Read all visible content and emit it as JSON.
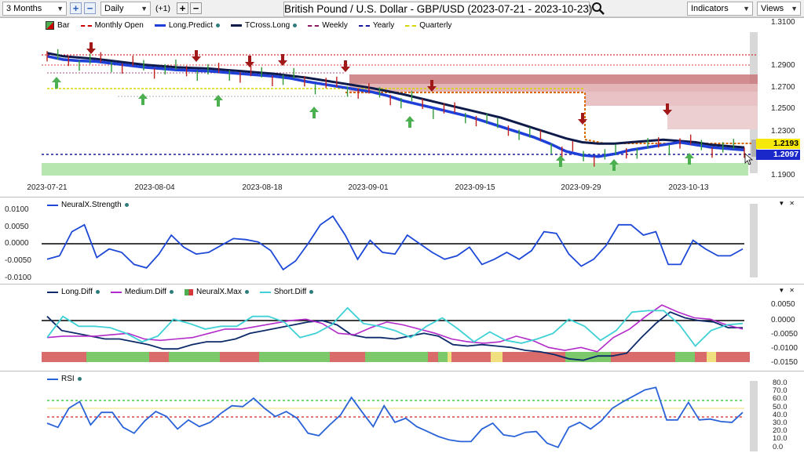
{
  "toolbar": {
    "range": "3 Months",
    "zoom_in": "+",
    "zoom_out": "−",
    "interval": "Daily",
    "offset": "(+1)",
    "step_plus": "+",
    "step_minus": "−",
    "title": "British Pound / U.S. Dollar - GBP/USD (2023-07-21 - 2023-10-23)",
    "indicators": "Indicators",
    "views": "Views"
  },
  "colors": {
    "long_predict": "#1e3fd8",
    "tcross": "#0d1a4a",
    "monthly_open": "#cc0000",
    "weekly": "#8b1a60",
    "yearly": "#1a1aa0",
    "quarterly": "#d6d600",
    "up_arrow": "#4caf50",
    "down_arrow": "#a01818",
    "neural_strength": "#1e49d8",
    "long_diff": "#0d2a6a",
    "medium_diff": "#b22ac9",
    "short_diff": "#3fd1d6",
    "rsi": "#2a63d8"
  },
  "price_panel": {
    "legend": [
      {
        "label": "Bar",
        "icon": "bar-icon"
      },
      {
        "label": "Monthly Open",
        "color": "#cc0000",
        "style": "dashed"
      },
      {
        "label": "Long.Predict",
        "color": "#1e3fd8",
        "style": "solid",
        "dot": true
      },
      {
        "label": "TCross.Long",
        "color": "#0d1a4a",
        "style": "solid",
        "dot": true
      },
      {
        "label": "Weekly",
        "color": "#8b1a60",
        "style": "dashed"
      },
      {
        "label": "Yearly",
        "color": "#1a1aa0",
        "style": "dashed"
      },
      {
        "label": "Quarterly",
        "color": "#d6d600",
        "style": "dashed"
      }
    ],
    "y_ticks": [
      "1.3100",
      "1.2900",
      "1.2700",
      "1.2500",
      "1.2300",
      "1.2100",
      "1.1900"
    ],
    "x_ticks": [
      "2023-07-21",
      "2023-08-04",
      "2023-08-18",
      "2023-09-01",
      "2023-09-15",
      "2023-09-29",
      "2023-10-13"
    ],
    "last_price": "1.2193",
    "yearly_level": "1.2097"
  },
  "neural_panel": {
    "legend": "NeuralX.Strength",
    "y_ticks": [
      "0.0100",
      "0.0050",
      "0.0000",
      "-0.0050",
      "-0.0100"
    ]
  },
  "diff_panel": {
    "legend": [
      "Long.Diff",
      "Medium.Diff",
      "NeuralX.Max",
      "Short.Diff"
    ],
    "y_ticks": [
      "0.0050",
      "0.0000",
      "-0.0050",
      "-0.0100",
      "-0.0150"
    ]
  },
  "rsi_panel": {
    "legend": "RSI",
    "y_ticks": [
      "80.0",
      "70.0",
      "60.0",
      "50.0",
      "40.0",
      "30.0",
      "20.0",
      "10.0",
      "0.0"
    ]
  },
  "chart_data": [
    {
      "type": "line",
      "title": "British Pound / U.S. Dollar - GBP/USD (2023-07-21 - 2023-10-23)",
      "x_range": [
        "2023-07-21",
        "2023-10-23"
      ],
      "ylim": [
        1.19,
        1.31
      ],
      "series": [
        {
          "name": "Long.Predict",
          "values": [
            1.2895,
            1.287,
            1.286,
            1.2855,
            1.284,
            1.2825,
            1.281,
            1.28,
            1.279,
            1.2785,
            1.278,
            1.277,
            1.276,
            1.275,
            1.274,
            1.2725,
            1.27,
            1.268,
            1.266,
            1.264,
            1.262,
            1.259,
            1.255,
            1.252,
            1.249,
            1.246,
            1.243,
            1.239,
            1.235,
            1.231,
            1.227,
            1.222,
            1.216,
            1.213,
            1.212,
            1.214,
            1.217,
            1.219,
            1.221,
            1.223,
            1.221,
            1.219,
            1.218,
            1.217
          ]
        },
        {
          "name": "TCross.Long",
          "values": [
            1.292,
            1.2895,
            1.2885,
            1.2875,
            1.286,
            1.2845,
            1.283,
            1.282,
            1.281,
            1.2805,
            1.28,
            1.279,
            1.278,
            1.277,
            1.276,
            1.2745,
            1.273,
            1.271,
            1.269,
            1.267,
            1.265,
            1.2625,
            1.26,
            1.257,
            1.254,
            1.251,
            1.248,
            1.245,
            1.242,
            1.238,
            1.234,
            1.23,
            1.226,
            1.223,
            1.222,
            1.222,
            1.223,
            1.224,
            1.225,
            1.224,
            1.223,
            1.221,
            1.22,
            1.219
          ]
        },
        {
          "name": "Monthly Open",
          "values": [
            1.2855,
            1.2855,
            1.2855,
            1.2855,
            1.2855,
            1.2855,
            1.2855,
            1.2855,
            1.2855,
            1.2855,
            1.2855,
            1.2855,
            1.2855,
            1.2855,
            1.2855,
            1.2855,
            1.2855,
            1.2855,
            1.2855,
            1.2855,
            1.2855,
            1.2855,
            1.2855,
            1.2855,
            1.2855,
            1.2855,
            1.2855,
            1.2855,
            1.2855,
            1.2855,
            1.2855,
            1.2855,
            1.2855,
            1.2855,
            1.2855,
            1.2855,
            1.2855,
            1.2855,
            1.2855,
            1.2855,
            1.2855,
            1.2855,
            1.2855,
            1.2855
          ]
        },
        {
          "name": "Yearly",
          "values": [
            1.2097
          ]
        }
      ]
    },
    {
      "type": "line",
      "series": [
        {
          "name": "NeuralX.Strength",
          "values": [
            -0.0045,
            -0.0035,
            0.0035,
            0.0055,
            -0.004,
            -0.0015,
            -0.0025,
            -0.006,
            -0.007,
            -0.003,
            0.0025,
            -0.001,
            -0.003,
            -0.0025,
            -0.0005,
            0.0015,
            0.0012,
            0.0005,
            -0.002,
            -0.0075,
            -0.005,
            0.0,
            0.0055,
            0.008,
            0.0025,
            -0.0045,
            0.001,
            -0.0025,
            -0.003,
            0.0025,
            0.0,
            -0.0025,
            -0.0045,
            -0.0035,
            -0.001,
            -0.006,
            -0.0045,
            -0.0025,
            -0.0045,
            -0.002,
            0.0035,
            0.003,
            -0.003,
            -0.0065,
            -0.0045,
            -0.0005,
            0.0055,
            0.0055,
            0.0025,
            0.0035,
            -0.006,
            -0.006,
            0.001,
            -0.0015,
            -0.0035,
            -0.0035,
            -0.0015
          ]
        }
      ],
      "ylim": [
        -0.01,
        0.01
      ]
    },
    {
      "type": "line",
      "series": [
        {
          "name": "Long.Diff",
          "values": [
            0.0015,
            -0.0035,
            -0.0045,
            -0.0055,
            -0.0065,
            -0.0065,
            -0.0075,
            -0.0085,
            -0.01,
            -0.01,
            -0.0085,
            -0.0075,
            -0.0075,
            -0.0065,
            -0.0045,
            -0.0035,
            -0.0025,
            -0.0015,
            -0.0005,
            0.0,
            -0.0015,
            -0.005,
            -0.006,
            -0.006,
            -0.0065,
            -0.0055,
            -0.0045,
            -0.0055,
            -0.0085,
            -0.009,
            -0.0085,
            -0.009,
            -0.0095,
            -0.0105,
            -0.011,
            -0.012,
            -0.0135,
            -0.014,
            -0.0125,
            -0.0125,
            -0.0115,
            -0.006,
            -0.001,
            0.003,
            0.001,
            0.0,
            -0.0005,
            -0.0025,
            -0.0025
          ]
        },
        {
          "name": "Medium.Diff",
          "values": [
            -0.006,
            -0.0055,
            -0.0055,
            -0.0055,
            -0.005,
            -0.0045,
            -0.0065,
            -0.007,
            -0.0065,
            -0.006,
            -0.0045,
            -0.003,
            -0.003,
            -0.002,
            -0.001,
            0.0,
            0.0005,
            -0.001,
            -0.0045,
            -0.005,
            -0.0025,
            -0.0005,
            -0.0015,
            -0.003,
            -0.0045,
            -0.0065,
            -0.0075,
            -0.008,
            -0.0075,
            -0.0055,
            -0.007,
            -0.0095,
            -0.0105,
            -0.0095,
            -0.011,
            -0.006,
            -0.003,
            0.0015,
            0.0055,
            0.003,
            0.001,
            0.0005,
            -0.0015,
            -0.003
          ]
        },
        {
          "name": "Short.Diff",
          "values": [
            -0.006,
            0.0015,
            -0.002,
            -0.002,
            -0.0025,
            -0.0045,
            -0.0075,
            -0.0055,
            0.0005,
            -0.001,
            -0.003,
            -0.002,
            -0.002,
            0.0015,
            0.0015,
            -0.0005,
            -0.006,
            -0.0045,
            -0.0015,
            0.0045,
            -0.001,
            -0.002,
            -0.0035,
            -0.006,
            -0.002,
            0.001,
            -0.003,
            -0.0075,
            -0.004,
            -0.007,
            -0.008,
            -0.0065,
            -0.0045,
            0.0005,
            -0.002,
            -0.007,
            -0.0035,
            0.003,
            0.0035,
            0.0035,
            -0.0015,
            -0.009,
            -0.0035,
            -0.0015,
            -0.001
          ]
        }
      ],
      "ylim": [
        -0.0155,
        0.0075
      ]
    },
    {
      "type": "line",
      "series": [
        {
          "name": "RSI",
          "values": [
            32,
            27,
            50,
            58,
            30,
            45,
            45,
            27,
            20,
            35,
            46,
            40,
            25,
            36,
            28,
            33,
            44,
            53,
            52,
            62,
            50,
            40,
            46,
            38,
            20,
            17,
            30,
            42,
            63,
            45,
            28,
            53,
            33,
            38,
            28,
            22,
            16,
            12,
            10,
            10,
            25,
            32,
            18,
            16,
            21,
            22,
            8,
            3,
            27,
            33,
            25,
            35,
            50,
            58,
            65,
            72,
            75,
            36,
            36,
            57,
            36,
            37,
            34,
            33,
            45
          ]
        }
      ],
      "ylim": [
        0,
        80
      ]
    }
  ]
}
